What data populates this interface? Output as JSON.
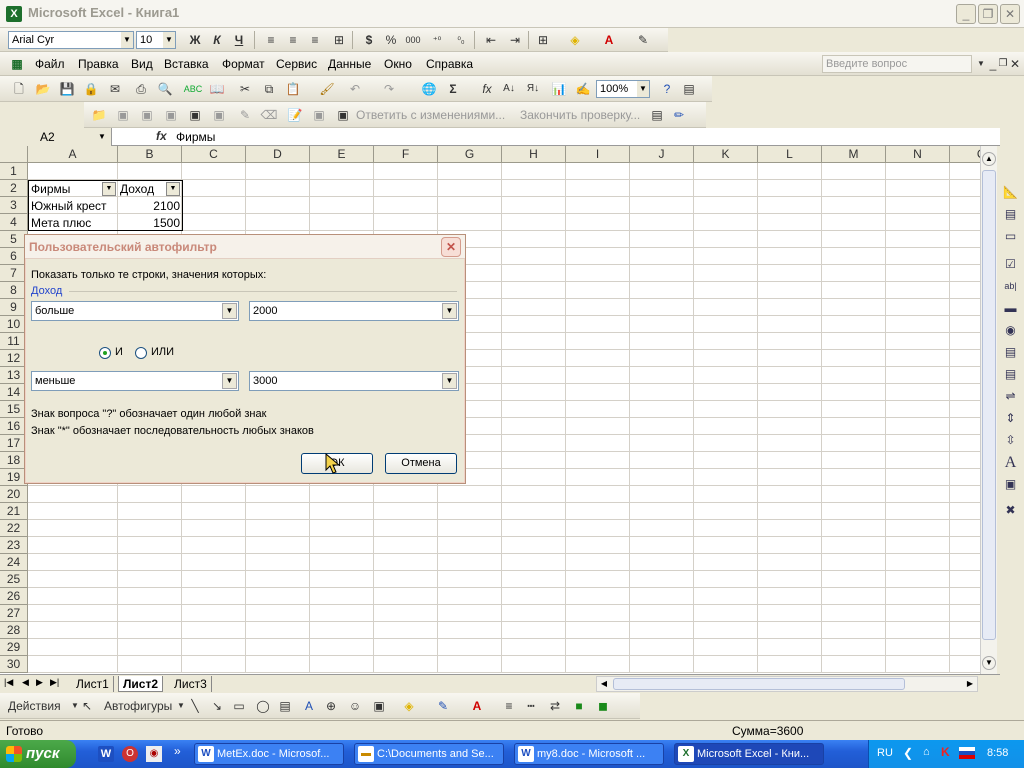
{
  "window": {
    "title": "Microsoft Excel - Книга1",
    "min": "_",
    "restore": "❐",
    "close": "✕"
  },
  "format_toolbar": {
    "font": "Arial Cyr",
    "size": "10",
    "bold": "Ж",
    "italic": "К",
    "underline": "Ч",
    "currency": "$",
    "percent": "%",
    "thousands": "000"
  },
  "menu": [
    "Файл",
    "Правка",
    "Вид",
    "Вставка",
    "Формат",
    "Сервис",
    "Данные",
    "Окно",
    "Справка"
  ],
  "question_box": {
    "placeholder": "Введите вопрос"
  },
  "std_toolbar": {
    "zoom": "100%",
    "sigma": "Σ",
    "fx": "fx"
  },
  "review_toolbar": {
    "reply": "Ответить с изменениями...",
    "end_review": "Закончить проверку..."
  },
  "formula": {
    "name_box": "A2",
    "fx": "fx",
    "content": "Фирмы"
  },
  "columns": [
    "A",
    "B",
    "C",
    "D",
    "E",
    "F",
    "G",
    "H",
    "I",
    "J",
    "K",
    "L",
    "M",
    "N",
    "O"
  ],
  "rows": [
    "1",
    "2",
    "3",
    "4",
    "5",
    "6",
    "7",
    "8",
    "9",
    "10",
    "11",
    "12",
    "13",
    "14",
    "15",
    "16",
    "17",
    "18",
    "19",
    "20",
    "21",
    "22",
    "23",
    "24",
    "25",
    "26",
    "27",
    "28",
    "29",
    "30"
  ],
  "cells": {
    "a2": "Фирмы",
    "b2": "Доход",
    "a3": "Южный крест",
    "b3": "2100",
    "a4": "Мета плюс",
    "b4": "1500"
  },
  "dialog": {
    "title": "Пользовательский автофильтр",
    "prompt": "Показать только те строки, значения которых:",
    "field": "Доход",
    "cond1_op": "больше",
    "cond1_val": "2000",
    "and_label": "И",
    "or_label": "ИЛИ",
    "cond2_op": "меньше",
    "cond2_val": "3000",
    "hint1": "Знак вопроса \"?\" обозначает один любой знак",
    "hint2": "Знак \"*\" обозначает последовательность любых знаков",
    "ok": "ОК",
    "cancel": "Отмена"
  },
  "sheet_tabs": [
    "Лист1",
    "Лист2",
    "Лист3"
  ],
  "active_sheet": "Лист2",
  "draw_toolbar": {
    "actions": "Действия",
    "autoshapes": "Автофигуры"
  },
  "status": {
    "left": "Готово",
    "sum": "Сумма=3600"
  },
  "taskbar": {
    "start": "пуск",
    "tasks": [
      "MetEx.doc - Microsof...",
      "C:\\Documents and Se...",
      "my8.doc - Microsoft ...",
      "Microsoft Excel - Кни..."
    ],
    "lang": "RU",
    "time": "8:58"
  },
  "colors": {
    "accent": "#316ac5",
    "dialog_title": "#c9897a",
    "taskbar": "#225fd8",
    "start": "#2f8a2d"
  }
}
